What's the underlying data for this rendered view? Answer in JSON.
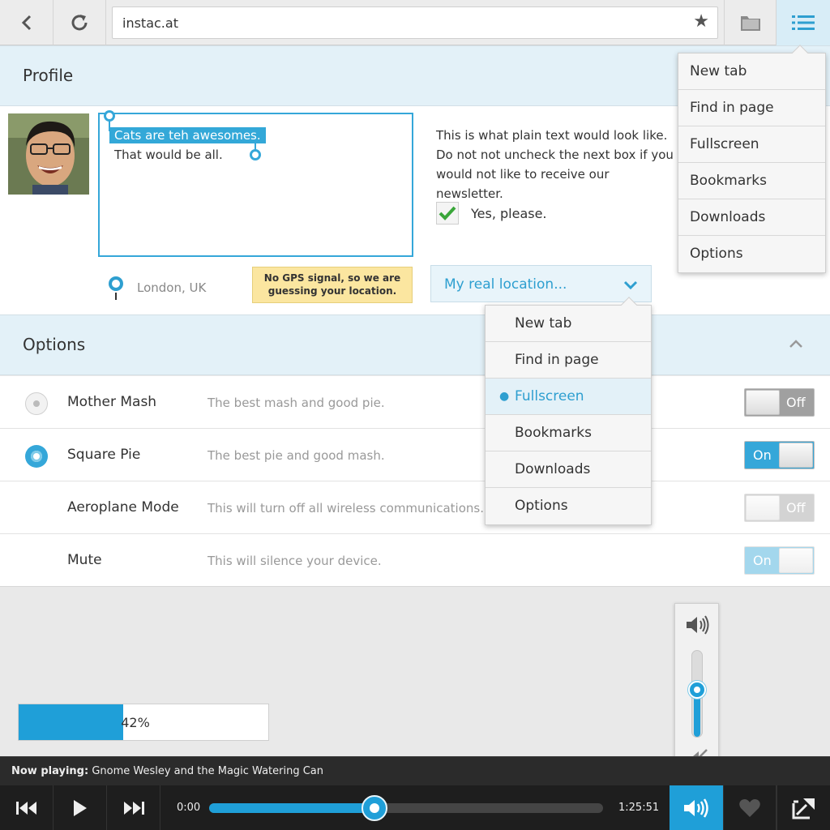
{
  "browser": {
    "url": "instac.at",
    "icons": {
      "back": "back-icon",
      "reload": "reload-icon",
      "bookmark": "star-icon",
      "folder": "folder-icon",
      "menu": "menu-icon"
    }
  },
  "profile": {
    "title": "Profile",
    "textarea": {
      "selected_text": "Cats are teh awesomes.",
      "second_line": "That would be all."
    },
    "plain_text": "This is what plain text would look like. Do not not uncheck the next box if you would not like to receive our newsletter.",
    "checkbox": {
      "label": "Yes, please.",
      "checked": true
    },
    "location": {
      "city": "London, UK",
      "gps_note": "No GPS signal, so we are guessing your location.",
      "select_value": "My real location..."
    }
  },
  "top_menu": {
    "items": [
      {
        "label": "New tab"
      },
      {
        "label": "Find in page"
      },
      {
        "label": "Fullscreen"
      },
      {
        "label": "Bookmarks"
      },
      {
        "label": "Downloads"
      },
      {
        "label": "Options"
      }
    ]
  },
  "location_menu": {
    "items": [
      {
        "label": "New tab"
      },
      {
        "label": "Find in page"
      },
      {
        "label": "Fullscreen",
        "selected": true
      },
      {
        "label": "Bookmarks"
      },
      {
        "label": "Downloads"
      },
      {
        "label": "Options"
      }
    ]
  },
  "options": {
    "title": "Options",
    "rows": [
      {
        "name": "Mother Mash",
        "desc": "The best mash and good pie.",
        "radio": "off",
        "toggle": "Off",
        "toggle_on": false,
        "disabled": false
      },
      {
        "name": "Square Pie",
        "desc": "The best pie and good mash.",
        "radio": "on",
        "toggle": "On",
        "toggle_on": true,
        "disabled": false
      },
      {
        "name": "Aeroplane Mode",
        "desc": "This will turn off all wireless communications.",
        "radio": "none",
        "toggle": "Off",
        "toggle_on": false,
        "disabled": true
      },
      {
        "name": "Mute",
        "desc": "This will silence your device.",
        "radio": "none",
        "toggle": "On",
        "toggle_on": true,
        "disabled": true
      }
    ]
  },
  "progress": {
    "value": 0.42,
    "label": "42%"
  },
  "volume": {
    "level": 0.55
  },
  "player": {
    "now_playing_label": "Now playing:",
    "track": "Gnome Wesley and the Magic Watering Can",
    "current_time": "0:00",
    "total_time": "1:25:51",
    "seek_position": 0.42
  },
  "colors": {
    "accent": "#1f9fd8",
    "header_bg": "#e3f1f8",
    "note_bg": "#fbe6a0",
    "player_bg": "#1e1e1e"
  }
}
